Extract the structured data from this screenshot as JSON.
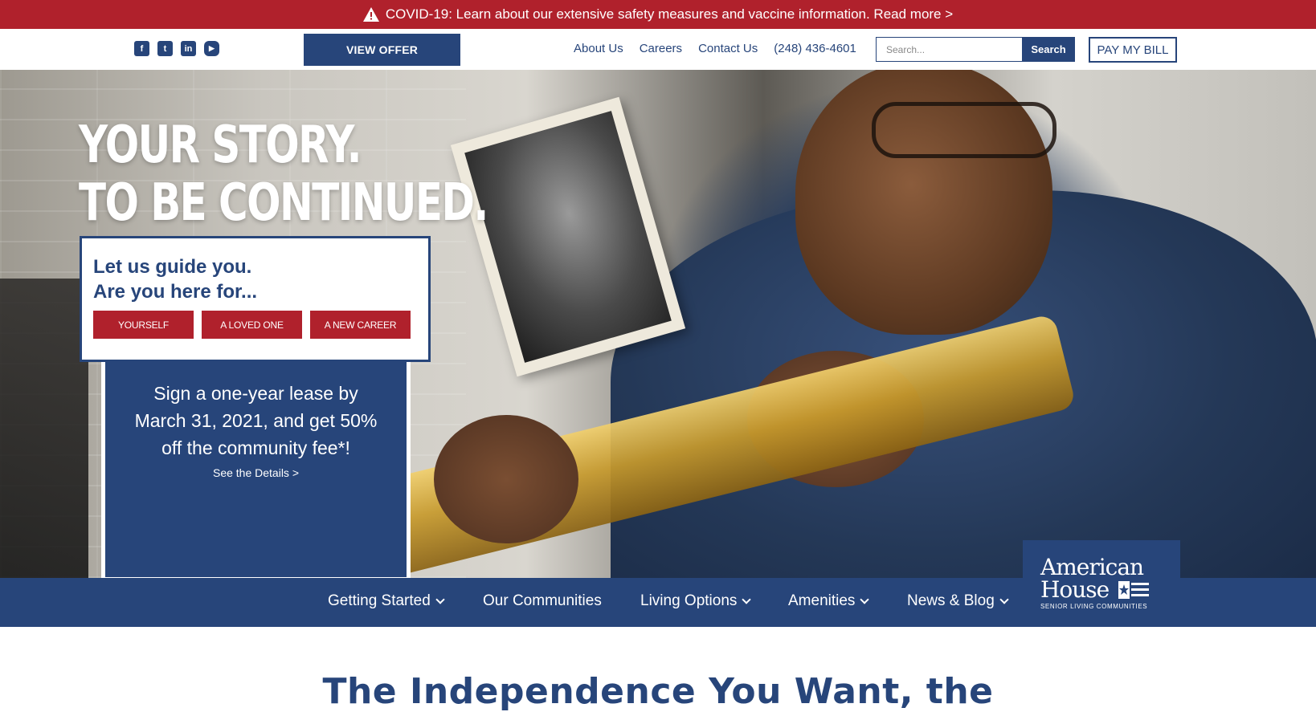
{
  "covid_banner": {
    "text": "COVID-19: Learn about our extensive safety measures and vaccine information. Read more >",
    "icon": "warning-icon",
    "color": "#b0212c"
  },
  "header": {
    "social": [
      {
        "icon": "facebook-icon",
        "glyph": "f"
      },
      {
        "icon": "twitter-icon",
        "glyph": "t"
      },
      {
        "icon": "linkedin-icon",
        "glyph": "in"
      },
      {
        "icon": "youtube-icon",
        "glyph": "▶"
      }
    ],
    "view_offer_label": "VIEW OFFER",
    "links": [
      "About Us",
      "Careers",
      "Contact Us",
      "(248) 436-4601"
    ],
    "search": {
      "placeholder": "Search...",
      "button_label": "Search"
    },
    "pay_bill_label": "PAY MY BILL",
    "accent_color": "#27457a"
  },
  "hero": {
    "headline_line1": "YOUR STORY.",
    "headline_line2": "TO BE CONTINUED.",
    "guide": {
      "title_line1": "Let us guide you.",
      "title_line2": "Are you here for...",
      "buttons": [
        "YOURSELF",
        "A LOVED ONE",
        "A NEW CAREER"
      ]
    },
    "offer": {
      "text": "Sign a one-year lease by March 31, 2021, and get 50% off the community fee*!",
      "link": "See the Details >"
    }
  },
  "main_nav": {
    "items": [
      {
        "label": "Getting Started",
        "has_dropdown": true
      },
      {
        "label": "Our Communities",
        "has_dropdown": false
      },
      {
        "label": "Living Options",
        "has_dropdown": true
      },
      {
        "label": "Amenities",
        "has_dropdown": true
      },
      {
        "label": "News & Blog",
        "has_dropdown": true
      }
    ]
  },
  "logo": {
    "line1": "American",
    "line2": "House",
    "subtitle": "SENIOR LIVING COMMUNITIES"
  },
  "intro": {
    "heading": "The Independence You Want, the"
  }
}
